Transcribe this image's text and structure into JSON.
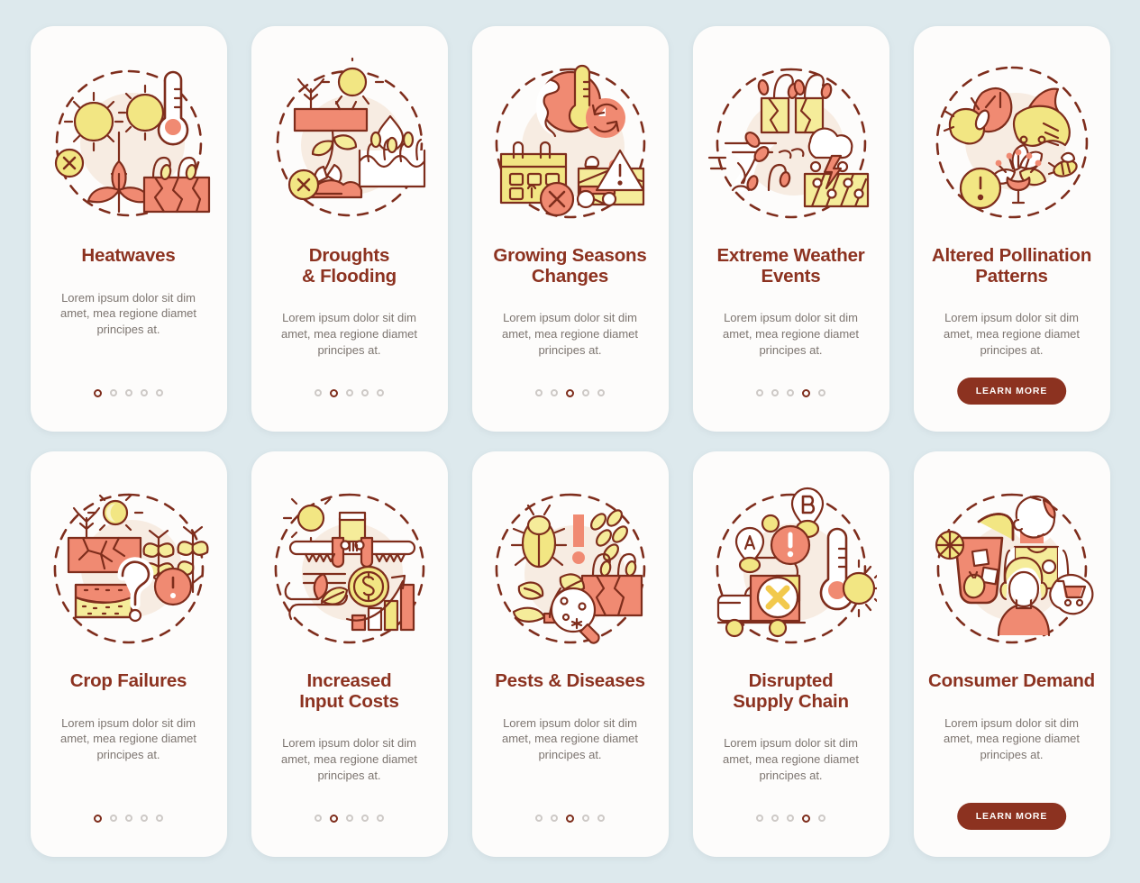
{
  "page": {
    "background_color": "#dde9ed",
    "card_background": "#fdfcfb",
    "title_color": "#8c3220",
    "body_color": "#7d7570",
    "accent_coral": "#f08a72",
    "accent_yellow": "#f2e683",
    "accent_dark": "#7e2d1c"
  },
  "shared": {
    "description": "Lorem ipsum dolor sit dim amet, mea regione diamet principes at.",
    "learn_more_label": "LEARN MORE",
    "dot_count": 5
  },
  "cards": [
    {
      "title": "Heatwaves",
      "icon": "heatwave-illustration",
      "description": "Lorem ipsum dolor sit dim amet, mea regione diamet principes at.",
      "active_dot": 1,
      "has_button": false
    },
    {
      "title": "Droughts\n& Flooding",
      "title_line1": "Droughts",
      "title_line2": "& Flooding",
      "icon": "drought-flooding-illustration",
      "description": "Lorem ipsum dolor sit dim amet, mea regione diamet principes at.",
      "active_dot": 2,
      "has_button": false
    },
    {
      "title": "Growing Seasons\nChanges",
      "title_line1": "Growing Seasons",
      "title_line2": "Changes",
      "icon": "growing-seasons-illustration",
      "description": "Lorem ipsum dolor sit dim amet, mea regione diamet principes at.",
      "active_dot": 3,
      "has_button": false
    },
    {
      "title": "Extreme Weather\nEvents",
      "title_line1": "Extreme Weather",
      "title_line2": "Events",
      "icon": "extreme-weather-illustration",
      "description": "Lorem ipsum dolor sit dim amet, mea regione diamet principes at.",
      "active_dot": 4,
      "has_button": false
    },
    {
      "title": "Altered Pollination\nPatterns",
      "title_line1": "Altered Pollination",
      "title_line2": "Patterns",
      "icon": "pollination-illustration",
      "description": "Lorem ipsum dolor sit dim amet, mea regione diamet principes at.",
      "active_dot": 0,
      "has_button": true,
      "button_label": "LEARN MORE"
    },
    {
      "title": "Crop Failures",
      "icon": "crop-failure-illustration",
      "description": "Lorem ipsum dolor sit dim amet, mea regione diamet principes at.",
      "active_dot": 1,
      "has_button": false
    },
    {
      "title": "Increased\nInput Costs",
      "title_line1": "Increased",
      "title_line2": "Input Costs",
      "icon": "input-costs-illustration",
      "description": "Lorem ipsum dolor sit dim amet, mea regione diamet principes at.",
      "active_dot": 2,
      "has_button": false
    },
    {
      "title": "Pests & Diseases",
      "icon": "pests-diseases-illustration",
      "description": "Lorem ipsum dolor sit dim amet, mea regione diamet principes at.",
      "active_dot": 3,
      "has_button": false
    },
    {
      "title": "Disrupted\nSupply Chain",
      "title_line1": "Disrupted",
      "title_line2": "Supply Chain",
      "icon": "supply-chain-illustration",
      "description": "Lorem ipsum dolor sit dim amet, mea regione diamet principes at.",
      "active_dot": 4,
      "has_button": false
    },
    {
      "title": "Consumer Demand",
      "icon": "consumer-demand-illustration",
      "description": "Lorem ipsum dolor sit dim amet, mea regione diamet principes at.",
      "active_dot": 0,
      "has_button": true,
      "button_label": "LEARN MORE"
    }
  ]
}
